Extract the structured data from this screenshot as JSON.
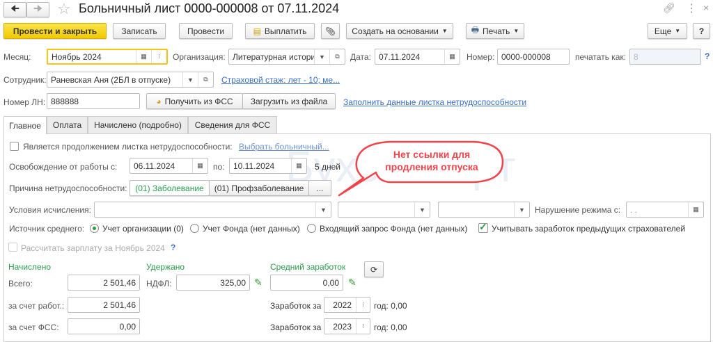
{
  "window": {
    "title": "Больничный лист 0000-000008 от 07.11.2024"
  },
  "toolbar": {
    "post_close": "Провести и закрыть",
    "save": "Записать",
    "post": "Провести",
    "pay": "Выплатить",
    "create_based": "Создать на основании",
    "print": "Печать",
    "more": "Еще",
    "help": "?"
  },
  "header": {
    "month_label": "Месяц:",
    "month_value": "Ноябрь 2024",
    "org_label": "Организация:",
    "org_value": "Литературная история",
    "date_label": "Дата:",
    "date_value": "07.11.2024",
    "number_label": "Номер:",
    "number_value": "0000-000008",
    "print_as_label": "печатать как:",
    "print_as_value": "8",
    "print_as_help": "?",
    "employee_label": "Сотрудник:",
    "employee_value": "Раневская Аня (2БЛ в отпуске)",
    "insurance_link": "Страховой стаж: лет - 10; ме...",
    "ln_label": "Номер ЛН:",
    "ln_value": "888888",
    "get_fss": "Получить из ФСС",
    "load_file": "Загрузить из файла",
    "fill_link": "Заполнить данные листка нетрудоспособности"
  },
  "tabs": [
    "Главное",
    "Оплата",
    "Начислено (подробно)",
    "Сведения для ФСС"
  ],
  "main": {
    "continuation_label": "Является продолжением листка нетрудоспособности:",
    "choose_link": "Выбрать больничный...",
    "release_label": "Освобождение от работы с:",
    "release_from": "06.11.2024",
    "to_label": "по:",
    "release_to": "10.11.2024",
    "days": "5 дней",
    "reason_label": "Причина нетрудоспособности:",
    "reason_1": "(01) Заболевание",
    "reason_2": "(01) Профзаболевание",
    "reason_more": "...",
    "conditions_label": "Условия исчисления:",
    "violation_label": "Нарушение режима с:",
    "violation_value": " .  .",
    "source_label": "Источник среднего:",
    "source_1": "Учет организации (0)",
    "source_2": "Учет Фонда (нет данных)",
    "source_3": "Входящий запрос Фонда (нет данных)",
    "prev_insurers": "Учитывать заработок предыдущих страхователей",
    "calc_salary": "Рассчитать зарплату за Ноябрь 2024",
    "calc_help": "?",
    "accrued_h": "Начислено",
    "withheld_h": "Удержано",
    "avg_h": "Средний заработок",
    "total_label": "Всего:",
    "total": "2 501,46",
    "ndfl_label": "НДФЛ:",
    "ndfl": "325,00",
    "avg": "0,00",
    "employer_label": "за счет работ.:",
    "employer": "2 501,46",
    "fss_label": "за счет ФСС:",
    "fss": "0,00",
    "earn_label": "Заработок за",
    "year1": "2022",
    "year1_val": "год: 0,00",
    "year2": "2023",
    "year2_val": "год: 0,00"
  },
  "callout": {
    "text": "Нет ссылки для продления отпуска",
    "color": "#f0434a"
  },
  "watermark": "Бухэксперт"
}
